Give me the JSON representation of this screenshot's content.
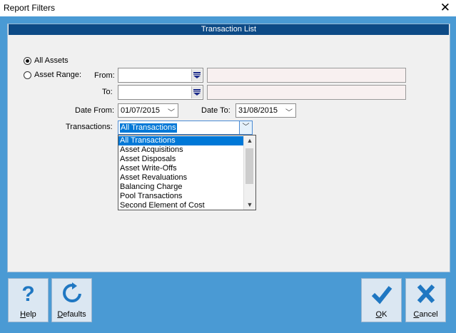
{
  "window": {
    "title": "Report Filters"
  },
  "section": {
    "header": "Transaction List"
  },
  "filters": {
    "all_assets_label": "All Assets",
    "asset_range_label": "Asset Range:",
    "from_label": "From:",
    "to_label": "To:",
    "date_from_label": "Date From:",
    "date_from_value": "01/07/2015",
    "date_to_label": "Date To:",
    "date_to_value": "31/08/2015",
    "transactions_label": "Transactions:",
    "transactions_value": "All Transactions",
    "selected_radio": "All Assets"
  },
  "dropdown": {
    "options": [
      "All Transactions",
      "Asset Acquisitions",
      "Asset Disposals",
      "Asset Write-Offs",
      "Asset Revaluations",
      "Balancing Charge",
      "Pool Transactions",
      "Second Element of Cost"
    ],
    "highlighted": "All Transactions"
  },
  "toolbar": {
    "help_key": "H",
    "help_rest": "elp",
    "defaults_key": "D",
    "defaults_rest": "efaults",
    "ok_key": "O",
    "ok_rest": "K",
    "cancel_key": "C",
    "cancel_rest": "ancel"
  },
  "colors": {
    "frame": "#4a9ad4",
    "header": "#0d4a86",
    "accent": "#1f77c2",
    "selection": "#0078d7"
  }
}
